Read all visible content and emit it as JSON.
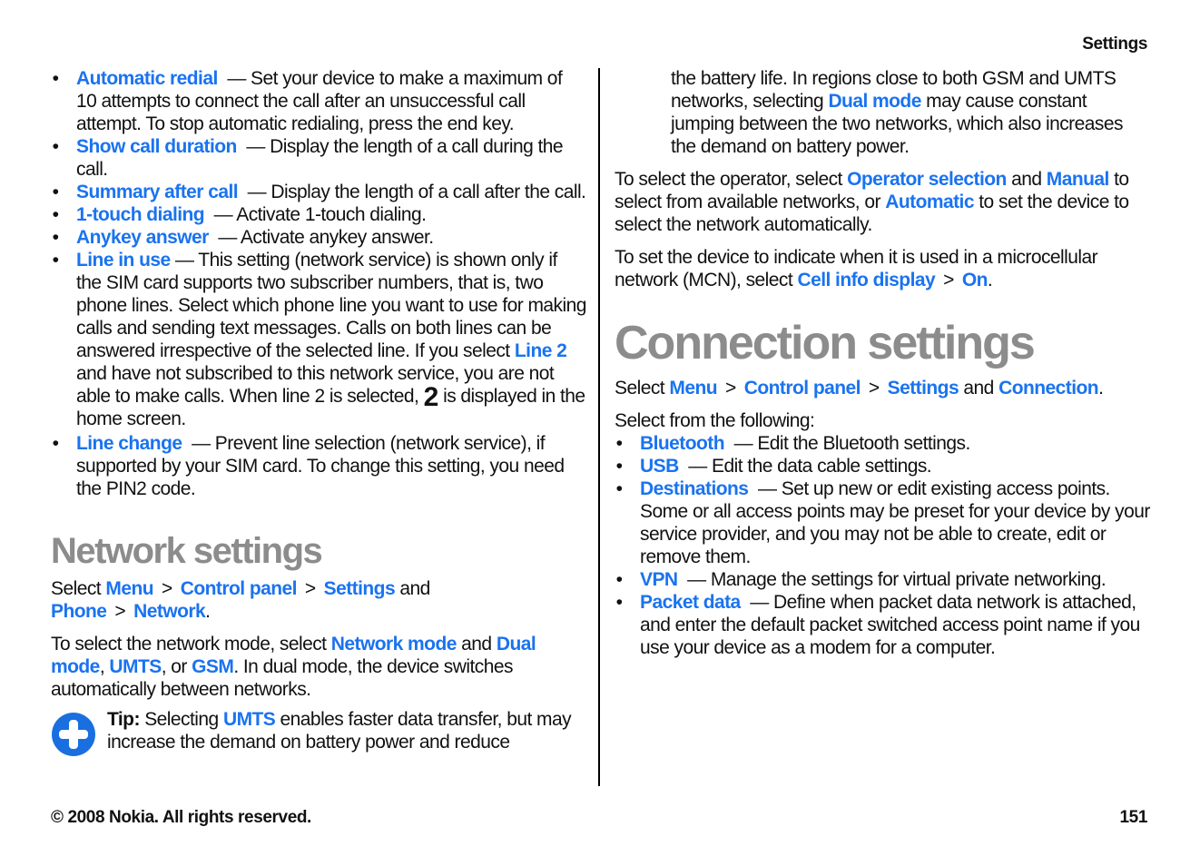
{
  "header": {
    "section_title": "Settings"
  },
  "left_column": {
    "call_settings_items": [
      {
        "term": "Automatic redial",
        "desc": "— Set your device to make a maximum of 10 attempts to connect the call after an unsuccessful call attempt. To stop automatic redialing, press the end key."
      },
      {
        "term": "Show call duration",
        "desc": "— Display the length of a call during the call."
      },
      {
        "term": "Summary after call",
        "desc": "— Display the length of a call after the call."
      },
      {
        "term": "1-touch dialing",
        "desc": "— Activate 1-touch dialing."
      },
      {
        "term": "Anykey answer",
        "desc": "— Activate anykey answer."
      }
    ],
    "line_in_use": {
      "term": "Line in use",
      "desc_part1": "— This setting (network service) is shown only if the SIM card supports two subscriber numbers, that is, two phone lines. Select which phone line you want to use for making calls and sending text messages. Calls on both lines can be answered irrespective of the selected line. If you select",
      "kw_line2": "Line 2",
      "desc_part2": "and have not subscribed to this network service, you are not able to make calls. When line 2 is selected,",
      "line2_indicator_icon": "2",
      "desc_part3": "is displayed in the home screen."
    },
    "line_change": {
      "term": "Line change",
      "desc": "— Prevent line selection (network service), if supported by your SIM card. To change this setting, you need the PIN2 code."
    },
    "network_settings": {
      "heading": "Network settings",
      "path_prefix": "Select",
      "path": [
        "Menu",
        "Control panel",
        "Settings"
      ],
      "path_and": "and",
      "path_phone": "Phone",
      "path_network": "Network",
      "separator": ">",
      "para2_a": "To select the network mode, select",
      "kw_network_mode": "Network mode",
      "para2_and": "and",
      "kw_dual_mode": "Dual mode",
      "kw_umts": "UMTS",
      "para2_or": ", or",
      "kw_gsm": "GSM",
      "para2_b": ". In dual mode, the device switches automatically between networks.",
      "tip": {
        "icon": "plus-circle-icon",
        "label": "Tip:",
        "text_a": "Selecting",
        "kw_umts": "UMTS",
        "text_b": "enables faster data transfer, but may increase the demand on battery power and reduce"
      }
    }
  },
  "right_column": {
    "tip_continued_a": "the battery life. In regions close to both GSM and UMTS networks, selecting",
    "kw_dual_mode": "Dual mode",
    "tip_continued_b": "may cause constant jumping between the two networks, which also increases the demand on battery power.",
    "operator_para": {
      "a": "To select the operator, select",
      "kw_operator_selection": "Operator selection",
      "b": "and",
      "kw_manual": "Manual",
      "c": "to select from available networks, or",
      "kw_automatic": "Automatic",
      "d": "to set the device to select the network automatically."
    },
    "mcn_para": {
      "a": "To set the device to indicate when it is used in a microcellular network (MCN), select",
      "kw_cell_info": "Cell info display",
      "separator": ">",
      "kw_on": "On"
    },
    "connection_settings": {
      "heading": "Connection settings",
      "path_prefix": "Select",
      "path": [
        "Menu",
        "Control panel",
        "Settings"
      ],
      "path_and": "and",
      "path_connection": "Connection",
      "separator": ">",
      "intro": "Select from the following:",
      "items": [
        {
          "term": "Bluetooth",
          "desc": "— Edit the Bluetooth settings."
        },
        {
          "term": "USB",
          "desc": "— Edit the data cable settings."
        },
        {
          "term": "Destinations",
          "desc": "— Set up new or edit existing access points. Some or all access points may be preset for your device by your service provider, and you may not be able to create, edit or remove them."
        },
        {
          "term": "VPN",
          "desc": "— Manage the settings for virtual private networking."
        },
        {
          "term": "Packet data",
          "desc": "— Define when packet data network is attached, and enter the default packet switched access point name if you use your device as a modem for a computer."
        }
      ]
    }
  },
  "footer": {
    "copyright": "© 2008 Nokia. All rights reserved.",
    "page_number": "151"
  },
  "colors": {
    "keyword": "#1a73f0",
    "heading": "#8c8c8c",
    "text": "#111111"
  }
}
